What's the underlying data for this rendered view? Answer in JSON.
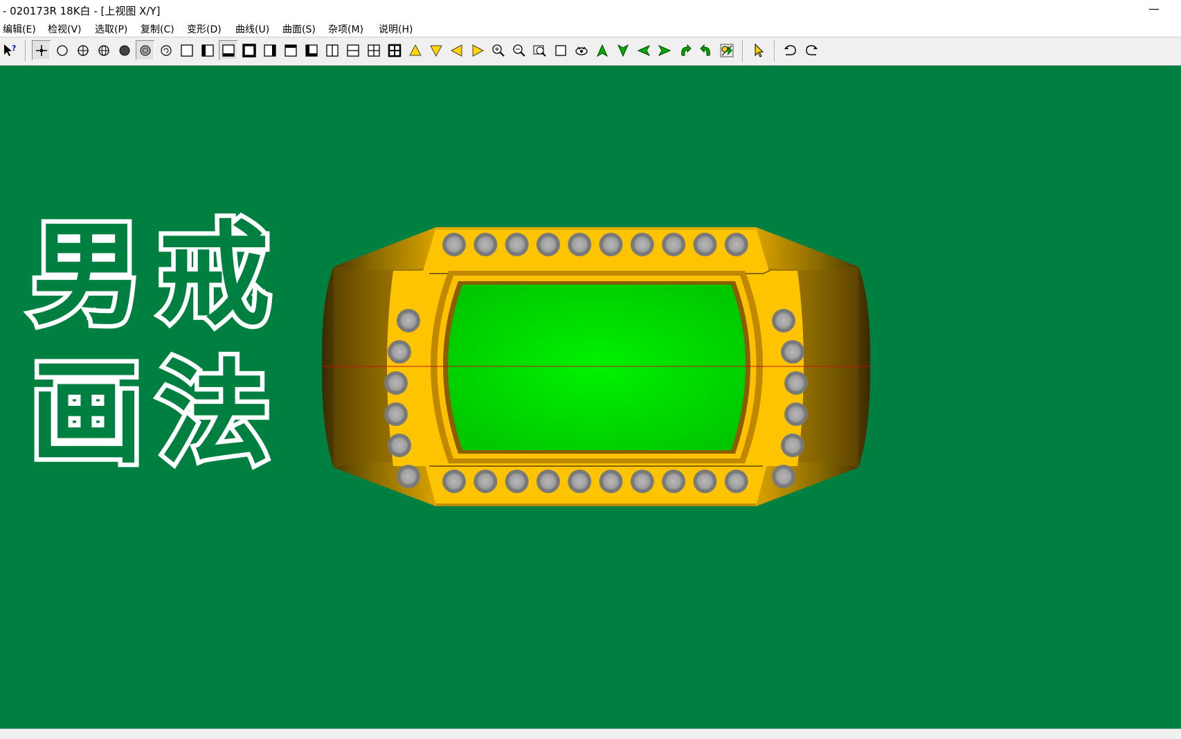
{
  "window": {
    "title": "- 020173R 18K白 - [上视图 X/Y]",
    "minimize_glyph": "—"
  },
  "menu": {
    "items": [
      "编辑(E)",
      "检视(V)",
      "选取(P)",
      "复制(C)",
      "变形(D)",
      "曲线(U)",
      "曲面(S)",
      "杂项(M)",
      "说明(H)"
    ]
  },
  "toolbar": {
    "groups": [
      [
        "help-cursor-icon"
      ],
      [
        "point-icon",
        "circle-icon",
        "circle-cross-icon",
        "sphere-icon",
        "filled-circle-icon",
        "shaded-circle-icon",
        "rotate-circle-icon",
        "view-single-icon",
        "view-left-icon",
        "view-top-icon",
        "view-bold-icon",
        "view-right-icon",
        "view-header-icon",
        "view-corner-icon",
        "split-vertical-icon",
        "split-horizontal-icon",
        "split-four-icon",
        "split-four-bold-icon",
        "arrow-up-icon",
        "arrow-down-icon",
        "arrow-left-icon",
        "arrow-right-icon",
        "zoom-in-icon",
        "zoom-out-icon",
        "zoom-window-icon",
        "frame-icon",
        "orbit-icon",
        "nav-up-icon",
        "nav-down-icon",
        "nav-left-icon",
        "nav-right-icon",
        "rotate-cw-icon",
        "rotate-ccw-icon",
        "render-icon"
      ],
      [
        "select-pointer-icon"
      ],
      [
        "undo-icon",
        "redo-icon"
      ]
    ],
    "pressed": [
      "point-icon",
      "shaded-circle-icon",
      "view-top-icon"
    ]
  },
  "viewport": {
    "caption_line1": "男戒",
    "caption_line2": "画法",
    "view_name": "上视图 X/Y",
    "background_color": "#008040",
    "metal_color": "#ffc400",
    "stone_table_color": "#00ee00",
    "prong_stone_color": "#a0a0a0",
    "axis_color": "#cc1010"
  },
  "ring": {
    "top_row_stones": 10,
    "bottom_row_stones": 10,
    "left_column_stones": 6,
    "right_column_stones": 6
  }
}
